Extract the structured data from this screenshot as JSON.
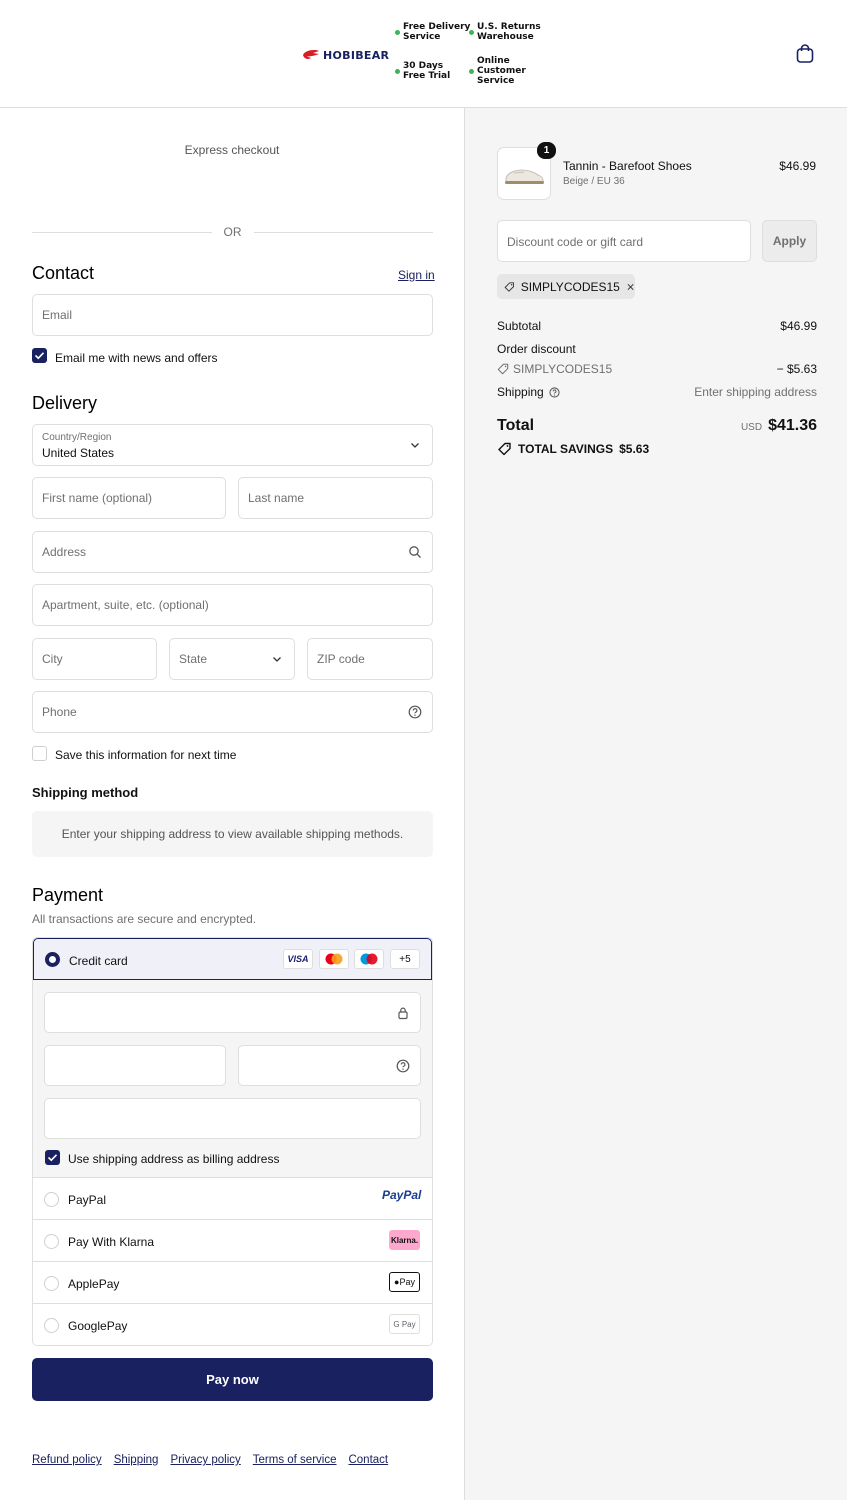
{
  "header": {
    "brand": "HOBIBEAR",
    "perks": [
      {
        "text": "Free Delivery\nService"
      },
      {
        "text": "U.S. Returns\nWarehouse"
      },
      {
        "text": "30 Days\nFree Trial"
      },
      {
        "text": "Online\nCustomer\nService"
      }
    ],
    "cart_icon": "shopping-bag-icon"
  },
  "express": {
    "label": "Express checkout",
    "or": "OR"
  },
  "contact": {
    "title": "Contact",
    "sign_in": "Sign in",
    "email_placeholder": "Email",
    "newsletter_label": "Email me with news and offers",
    "newsletter_checked": true
  },
  "delivery": {
    "title": "Delivery",
    "country_label": "Country/Region",
    "country_value": "United States",
    "first_name": "First name (optional)",
    "last_name": "Last name",
    "address": "Address",
    "apartment": "Apartment, suite, etc. (optional)",
    "city": "City",
    "state": "State",
    "zip": "ZIP code",
    "phone": "Phone",
    "save_label": "Save this information for next time",
    "save_checked": false
  },
  "shipping_method": {
    "title": "Shipping method",
    "message": "Enter your shipping address to view available shipping methods."
  },
  "payment": {
    "title": "Payment",
    "subtitle": "All transactions are secure and encrypted.",
    "credit_card": "Credit card",
    "card_brands": [
      "VISA",
      "mastercard",
      "maestro"
    ],
    "more_cards": "+5",
    "billing_label": "Use shipping address as billing address",
    "billing_checked": true,
    "methods": [
      {
        "label": "PayPal",
        "badge": "PayPal"
      },
      {
        "label": "Pay With Klarna",
        "badge": "Klarna."
      },
      {
        "label": "ApplePay",
        "badge": "Pay"
      },
      {
        "label": "GooglePay",
        "badge": "G Pay"
      }
    ],
    "pay_now": "Pay now"
  },
  "footer": {
    "links": [
      "Refund policy",
      "Shipping",
      "Privacy policy",
      "Terms of service",
      "Contact"
    ]
  },
  "summary": {
    "product_name": "Tannin - Barefoot Shoes",
    "product_variant": "Beige / EU 36",
    "product_price": "$46.99",
    "quantity": "1",
    "discount_placeholder": "Discount code or gift card",
    "apply": "Apply",
    "applied_code": "SIMPLYCODES15",
    "subtotal_label": "Subtotal",
    "subtotal_value": "$46.99",
    "order_discount_label": "Order discount",
    "discount_code": "SIMPLYCODES15",
    "discount_value": "− $5.63",
    "shipping_label": "Shipping",
    "shipping_value": "Enter shipping address",
    "total_label": "Total",
    "currency": "USD",
    "total_value": "$41.36",
    "savings_label": "TOTAL SAVINGS",
    "savings_value": "$5.63"
  },
  "colors": {
    "accent": "#1a2160",
    "perk_dot": "#3db35a",
    "summary_bg": "#f5f5f5"
  }
}
